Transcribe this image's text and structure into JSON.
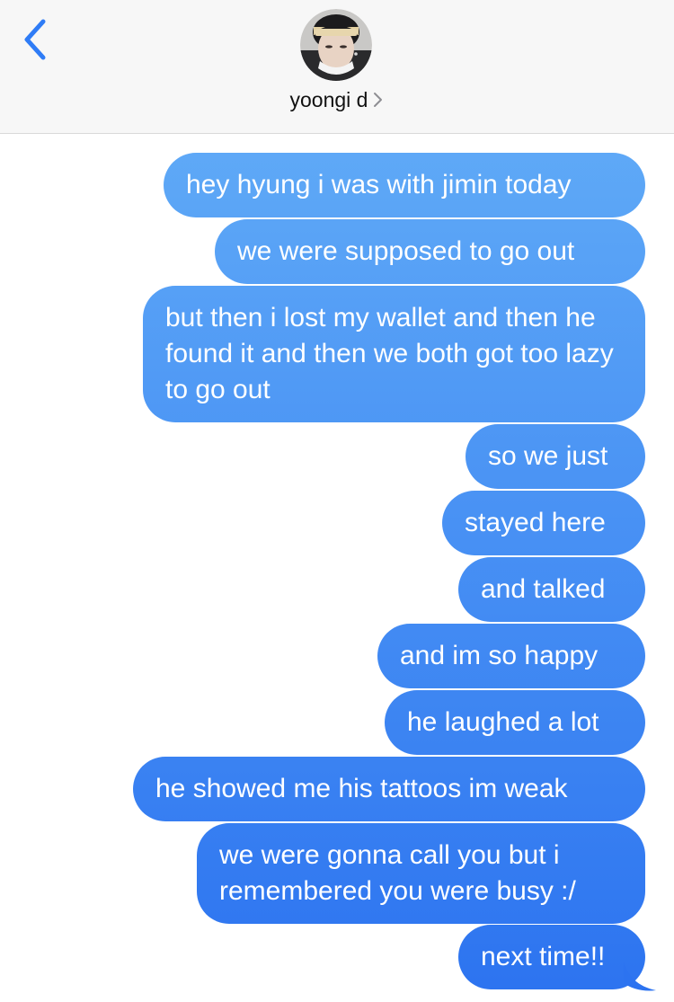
{
  "header": {
    "contact_name": "yoongi d",
    "back_icon": "chevron-left-icon",
    "avatar_icon": "contact-photo"
  },
  "colors": {
    "accent": "#2f7cf6",
    "bubble_top": "#67b2f8",
    "bubble_bottom": "#2c73f0",
    "header_bg": "#f7f7f7"
  },
  "messages": [
    {
      "text": "hey hyung i was with jimin today"
    },
    {
      "text": "we were supposed to go out"
    },
    {
      "text": "but then i lost my wallet and then he found it and then we both got too lazy to go out"
    },
    {
      "text": "so we just"
    },
    {
      "text": "stayed here"
    },
    {
      "text": "and talked"
    },
    {
      "text": "and im so happy"
    },
    {
      "text": "he laughed a lot"
    },
    {
      "text": "he showed me his tattoos im weak"
    },
    {
      "text": "we were gonna call you but i remembered you were busy :/"
    },
    {
      "text": "next time!!"
    }
  ]
}
